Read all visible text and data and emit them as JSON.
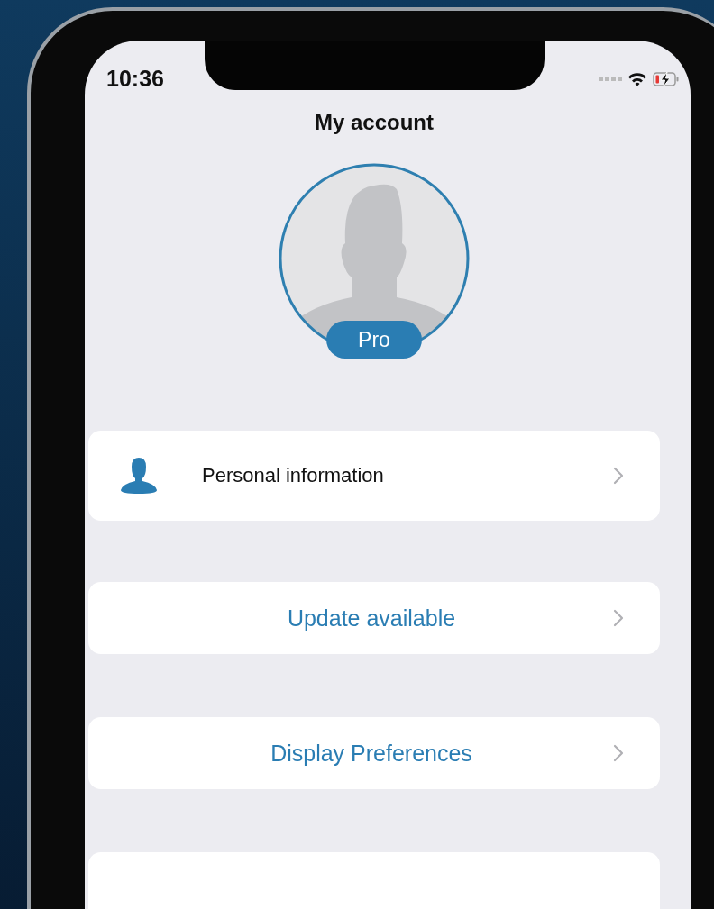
{
  "status_bar": {
    "time": "10:36",
    "battery_low": true,
    "charging": true
  },
  "title": "My account",
  "profile": {
    "badge": "Pro"
  },
  "rows": [
    {
      "kind": "detail",
      "label": "Personal information"
    },
    {
      "kind": "action",
      "label": "Update available"
    },
    {
      "kind": "action",
      "label": "Display Preferences"
    },
    {
      "kind": "blank"
    }
  ]
}
